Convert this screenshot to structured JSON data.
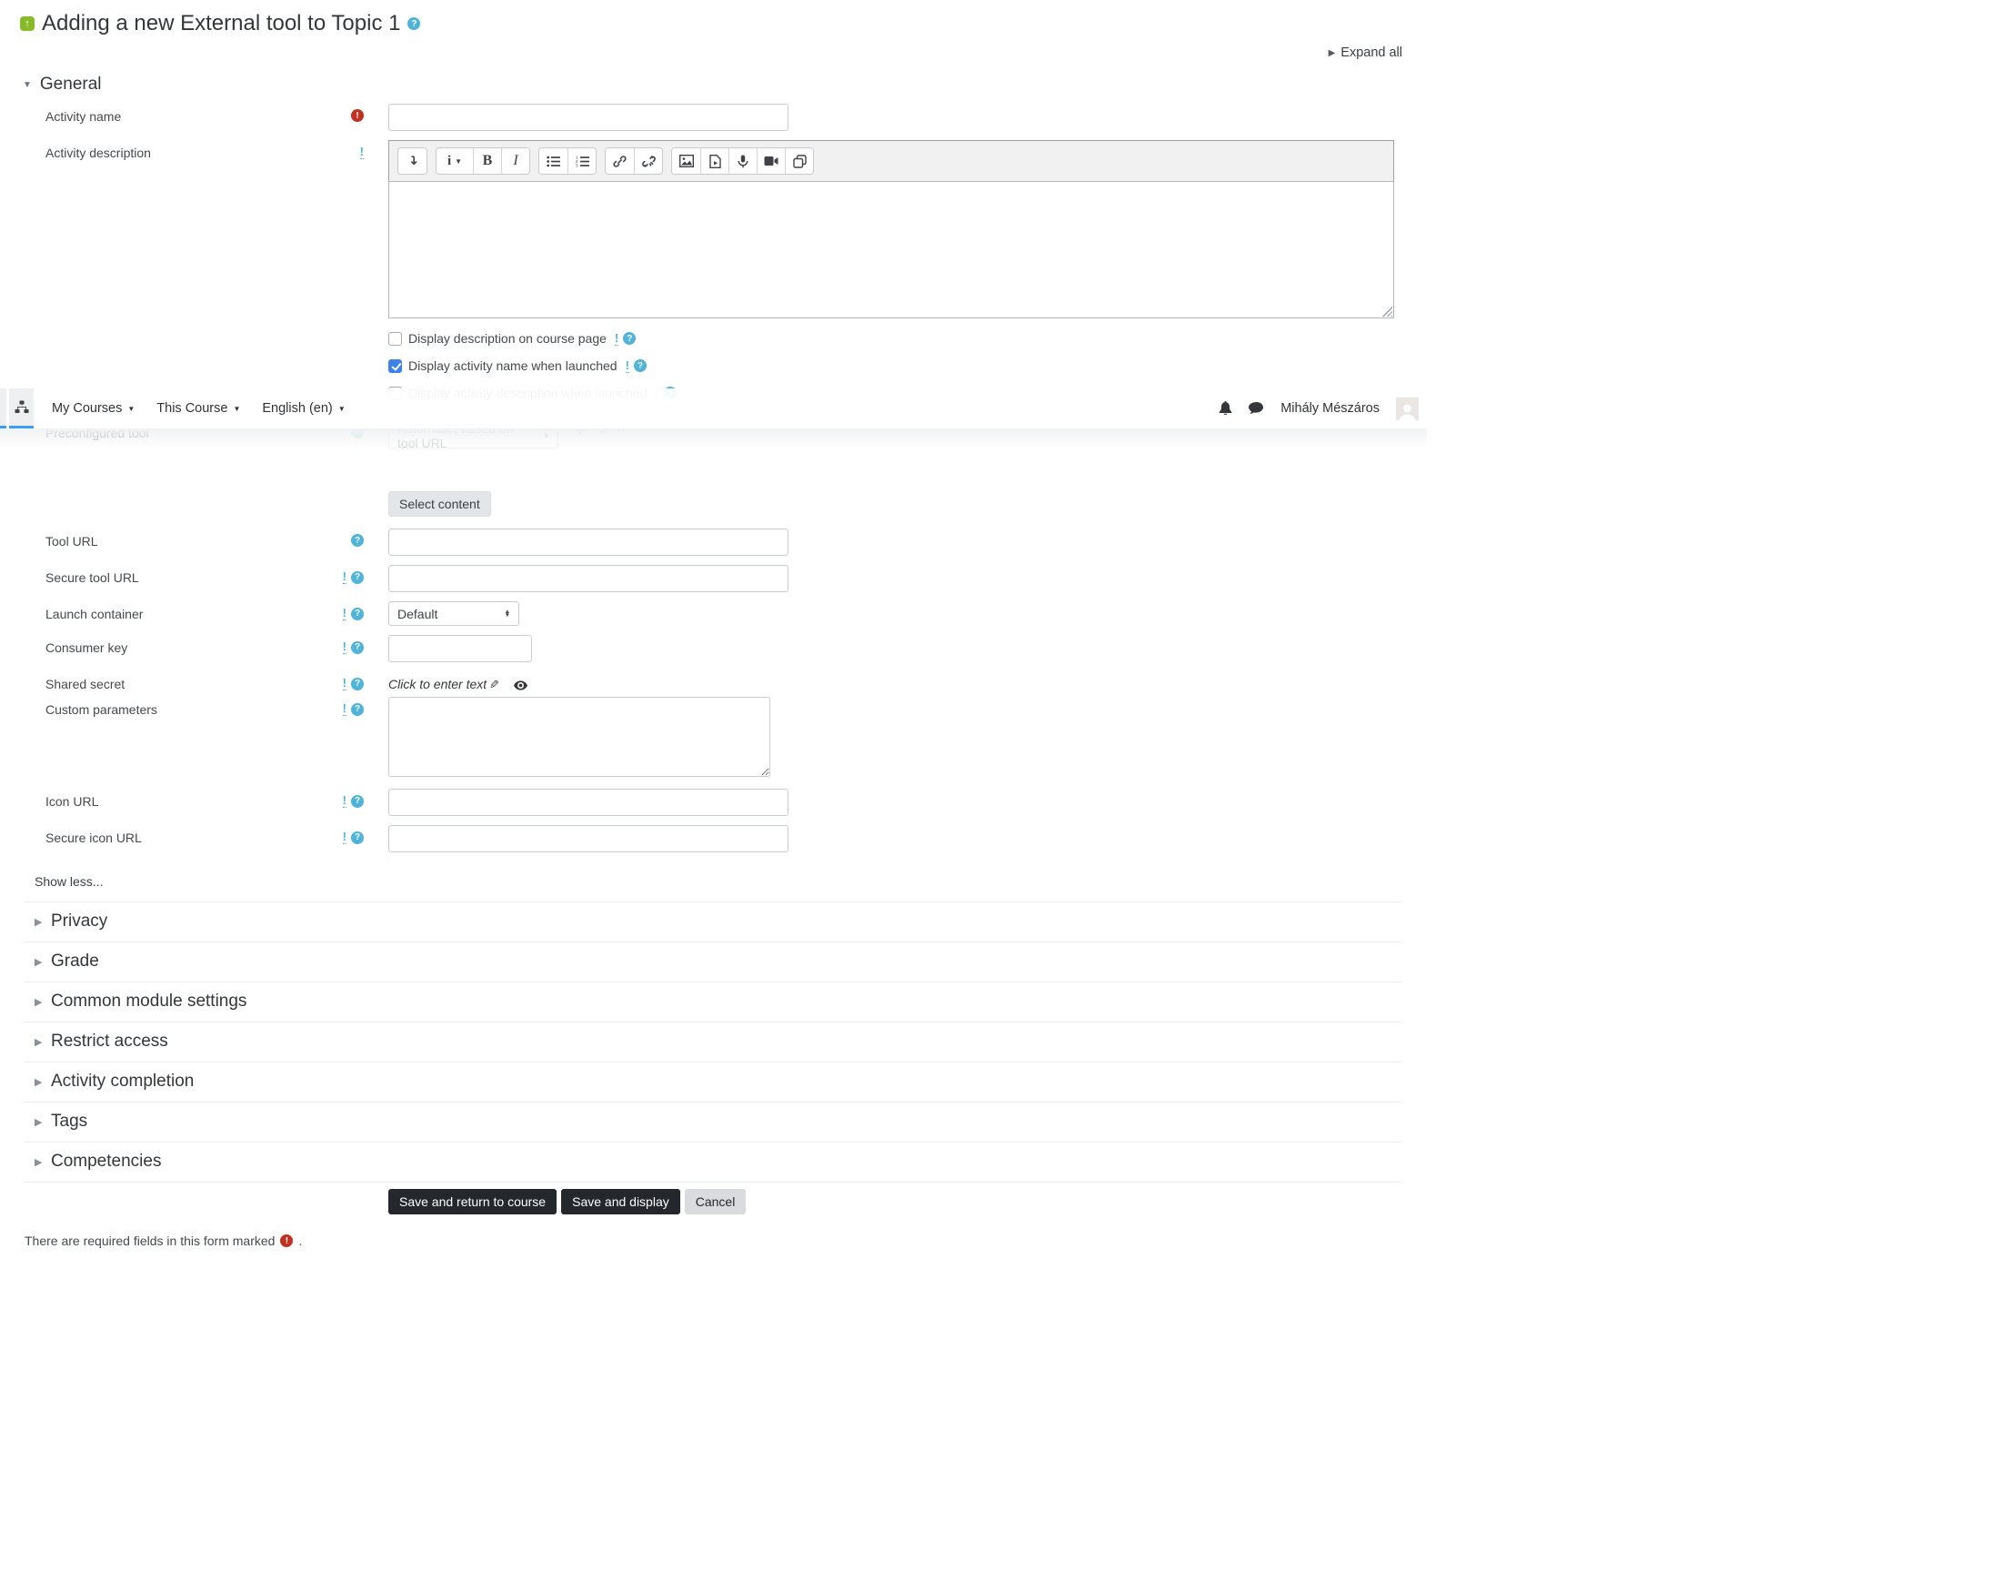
{
  "header": {
    "title": "Adding a new External tool to Topic 1",
    "expand_all": "Expand all"
  },
  "navbar": {
    "my_courses": "My Courses",
    "this_course": "This Course",
    "language": "English (en)",
    "user_name": "Mihály Mészáros",
    "icons": [
      "sitemap",
      "bell",
      "chat",
      "avatar"
    ]
  },
  "general": {
    "heading": "General",
    "activity_name": {
      "label": "Activity name",
      "value": ""
    },
    "activity_description": {
      "label": "Activity description",
      "value": ""
    },
    "checkboxes": [
      {
        "label": "Display description on course page",
        "checked": false
      },
      {
        "label": "Display activity name when launched",
        "checked": true
      },
      {
        "label": "Display activity description when launched",
        "checked": false
      }
    ],
    "preconfigured_tool": {
      "label": "Preconfigured tool",
      "selected": "Automatic, based on tool URL",
      "icon_glyphs": [
        "+",
        "⚙",
        "×"
      ]
    },
    "select_content": "Select content",
    "tool_url": {
      "label": "Tool URL",
      "value": ""
    },
    "secure_tool_url": {
      "label": "Secure tool URL",
      "value": ""
    },
    "launch_container": {
      "label": "Launch container",
      "selected": "Default"
    },
    "consumer_key": {
      "label": "Consumer key",
      "value": ""
    },
    "shared_secret": {
      "label": "Shared secret",
      "link": "Click to enter text"
    },
    "custom_parameters": {
      "label": "Custom parameters",
      "value": ""
    },
    "icon_url": {
      "label": "Icon URL",
      "value": ""
    },
    "secure_icon_url": {
      "label": "Secure icon URL",
      "value": ""
    },
    "show_less": "Show less..."
  },
  "editor": {
    "bold_glyph": "B",
    "italic_glyph": "I",
    "style_glyph": "i",
    "toolbar_icons": [
      "collapse-toolbar",
      "paragraph-style",
      "bold",
      "italic",
      "unordered-list",
      "ordered-list",
      "link",
      "unlink",
      "insert-image",
      "insert-media",
      "record-audio",
      "record-video",
      "manage-files"
    ]
  },
  "sections": [
    {
      "label": "Privacy"
    },
    {
      "label": "Grade"
    },
    {
      "label": "Common module settings"
    },
    {
      "label": "Restrict access"
    },
    {
      "label": "Activity completion"
    },
    {
      "label": "Tags"
    },
    {
      "label": "Competencies"
    }
  ],
  "actions": {
    "save_return": "Save and return to course",
    "save_display": "Save and display",
    "cancel": "Cancel"
  },
  "footer": {
    "required_note": "There are required fields in this form marked",
    "suffix": "."
  },
  "colors": {
    "tab_accent_blue": "#3b9ff5",
    "help_blue": "#4fb4d8",
    "required_red": "#c13120",
    "checkbox_blue": "#3d82e8",
    "button_dark": "#24272b",
    "tool_badge_green": "#87b929"
  }
}
